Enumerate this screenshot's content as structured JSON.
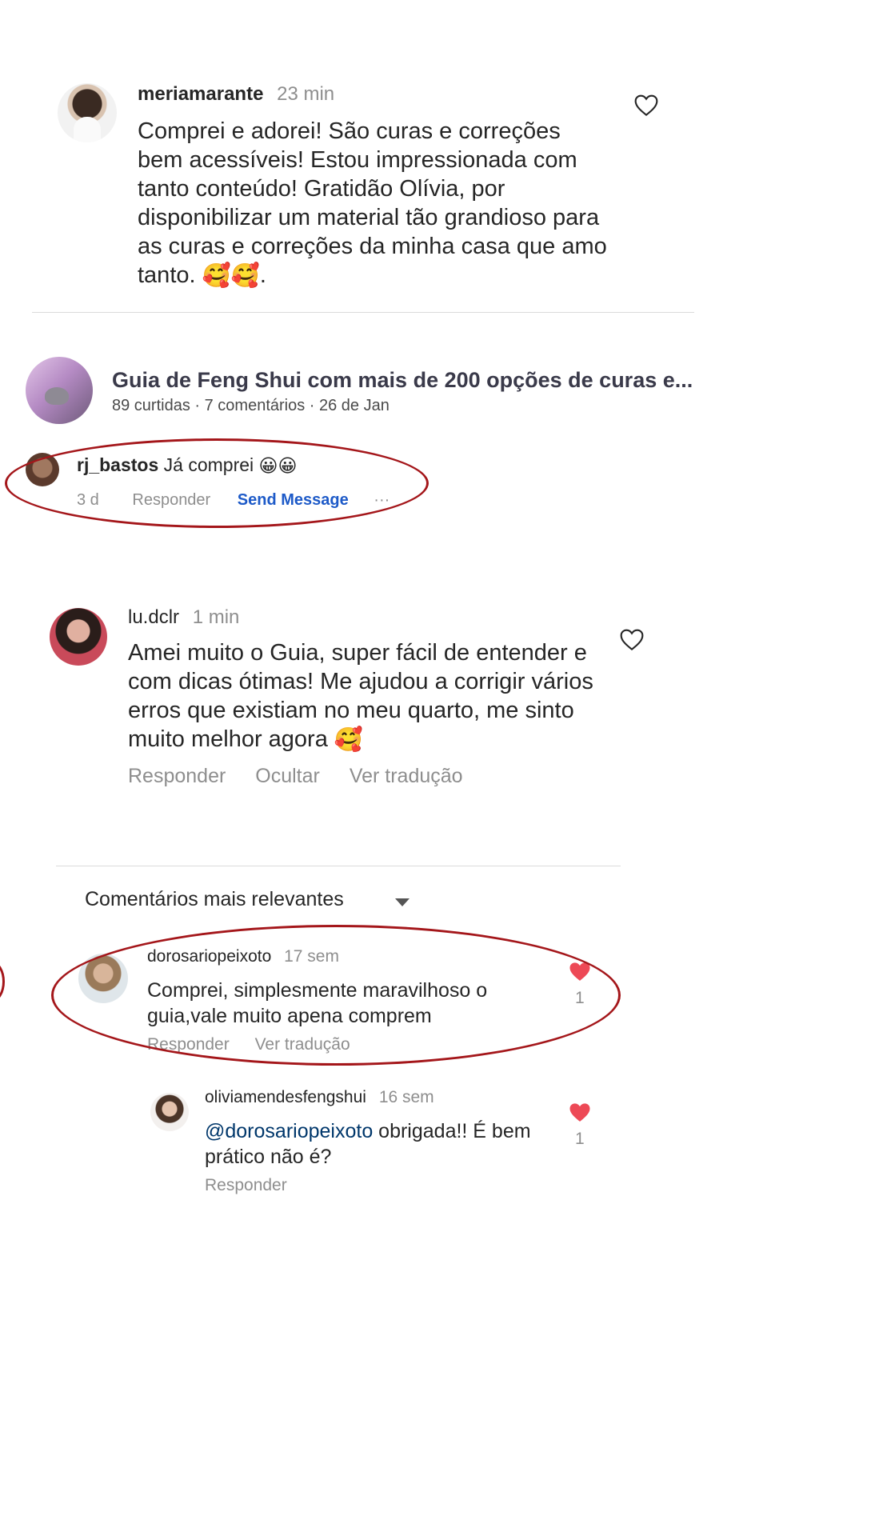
{
  "comments": {
    "c1": {
      "username": "meriamarante",
      "time": "23 min",
      "text": "Comprei e  adorei! São curas e correções bem acessíveis! Estou impressionada com tanto conteúdo! Gratidão Olívia, por disponibilizar um material tão grandioso para as curas e correções da minha casa que amo tanto.",
      "emoji_tail": "🥰🥰",
      "end": "."
    },
    "post": {
      "title": "Guia de Feng Shui com mais de 200 opções de curas e...",
      "meta": "89 curtidas · 7 comentários · 26 de Jan"
    },
    "c2": {
      "username": "rj_bastos",
      "text": "Já comprei",
      "emoji_tail": "😀😀",
      "time": "3 d",
      "reply": "Responder",
      "send_message": "Send Message",
      "more": "···"
    },
    "c3": {
      "username": "lu.dclr",
      "time": "1 min",
      "text": "Amei muito o Guia, super fácil de entender e com dicas ótimas! Me ajudou a corrigir vários erros que existiam no meu quarto, me sinto muito melhor agora",
      "emoji_tail": "🥰",
      "reply": "Responder",
      "hide": "Ocultar",
      "translate": "Ver tradução"
    },
    "sort": {
      "label": "Comentários mais relevantes"
    },
    "c4": {
      "username": "dorosariopeixoto",
      "time": "17 sem",
      "text": "Comprei, simplesmente maravilhoso o guia,vale muito apena comprem",
      "likes": "1",
      "reply": "Responder",
      "translate": "Ver tradução"
    },
    "c5": {
      "username": "oliviamendesfengshui",
      "time": "16 sem",
      "mention": "@dorosariopeixoto",
      "text": " obrigada!! É bem prático não é?",
      "likes": "1",
      "reply": "Responder"
    }
  },
  "colors": {
    "text": "#262626",
    "muted": "#8e8e8e",
    "link_blue": "#1d5ac8",
    "mention_blue": "#00376b",
    "heart_red": "#ed4956",
    "annotation_red": "#a4161a"
  },
  "icons": [
    "heart-outline-icon",
    "heart-filled-icon",
    "chevron-down-icon",
    "more-icon"
  ]
}
